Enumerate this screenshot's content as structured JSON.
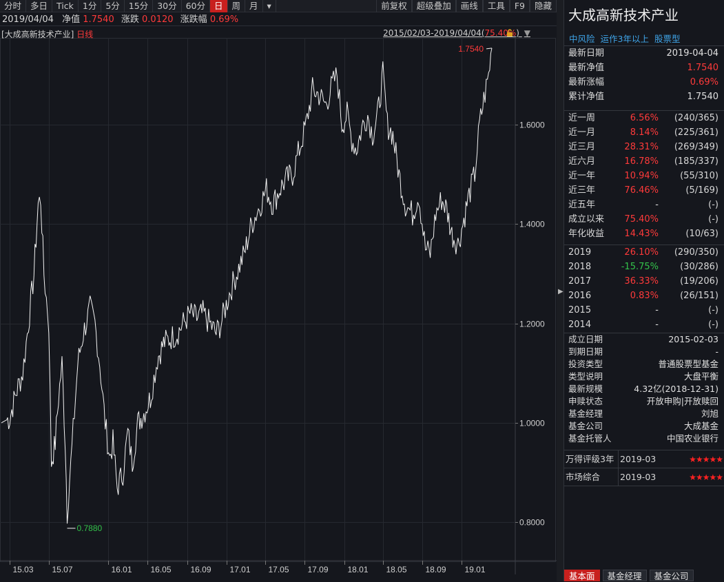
{
  "toolbar": {
    "items": [
      "分时",
      "多日",
      "Tick",
      "1分",
      "5分",
      "15分",
      "30分",
      "60分",
      "日",
      "周",
      "月",
      "▾"
    ],
    "active": "日",
    "right_items": [
      "前复权",
      "超级叠加",
      "画线",
      "工具",
      "F9",
      "隐藏"
    ]
  },
  "info_bar": {
    "date": "2019/04/04",
    "nav_label": "净值",
    "nav_value": "1.7540",
    "change_label": "涨跌",
    "change_value": "0.0120",
    "pct_label": "涨跌幅",
    "pct_value": "0.69%"
  },
  "chart": {
    "title": "[大成高新技术产业]",
    "period": "日线",
    "range": "2015/02/03-2019/04/04(",
    "range_pct": "75.40%",
    "range_close": ")",
    "max_label": "1.7540",
    "min_label": "0.7880"
  },
  "chart_data": {
    "type": "line",
    "title": "[大成高新技术产业] 日线",
    "xlabel": "",
    "ylabel": "",
    "x_ticks": [
      "15.03",
      "15.07",
      "16.01",
      "16.05",
      "16.09",
      "17.01",
      "17.05",
      "17.09",
      "18.01",
      "18.05",
      "18.09",
      "19.01"
    ],
    "y_ticks": [
      "0.8000",
      "1.0000",
      "1.2000",
      "1.4000",
      "1.6000"
    ],
    "ylim": [
      0.7,
      1.78
    ],
    "grid": true,
    "series": [
      {
        "name": "",
        "x": [
          "2015-02-03",
          "2015-03-01",
          "2015-03-20",
          "2015-04-10",
          "2015-04-28",
          "2015-05-15",
          "2015-05-28",
          "2015-06-05",
          "2015-06-15",
          "2015-06-30",
          "2015-07-08",
          "2015-07-20",
          "2015-07-30",
          "2015-08-10",
          "2015-08-20",
          "2015-08-26",
          "2015-09-10",
          "2015-09-28",
          "2015-10-15",
          "2015-11-05",
          "2015-11-20",
          "2015-12-05",
          "2015-12-22",
          "2016-01-05",
          "2016-01-15",
          "2016-01-28",
          "2016-02-15",
          "2016-03-01",
          "2016-03-15",
          "2016-04-01",
          "2016-04-20",
          "2016-05-10",
          "2016-06-01",
          "2016-06-20",
          "2016-07-10",
          "2016-08-01",
          "2016-08-20",
          "2016-09-10",
          "2016-10-01",
          "2016-10-20",
          "2016-11-10",
          "2016-11-30",
          "2016-12-15",
          "2017-01-10",
          "2017-02-01",
          "2017-02-25",
          "2017-03-20",
          "2017-04-10",
          "2017-05-05",
          "2017-05-25",
          "2017-06-15",
          "2017-07-05",
          "2017-07-25",
          "2017-08-15",
          "2017-09-05",
          "2017-09-25",
          "2017-10-15",
          "2017-11-05",
          "2017-11-25",
          "2017-12-10",
          "2017-12-25",
          "2018-01-10",
          "2018-01-25",
          "2018-02-08",
          "2018-02-28",
          "2018-03-15",
          "2018-03-30",
          "2018-04-15",
          "2018-05-01",
          "2018-05-15",
          "2018-06-01",
          "2018-06-20",
          "2018-07-10",
          "2018-08-01",
          "2018-08-20",
          "2018-09-10",
          "2018-09-25",
          "2018-10-12",
          "2018-10-30",
          "2018-11-15",
          "2018-12-01",
          "2018-12-20",
          "2019-01-04",
          "2019-01-20",
          "2019-02-10",
          "2019-02-25",
          "2019-03-10",
          "2019-03-25",
          "2019-04-04"
        ],
        "values": [
          1.0,
          1.01,
          1.06,
          1.1,
          1.2,
          1.3,
          1.44,
          1.45,
          1.3,
          1.2,
          0.92,
          0.96,
          1.05,
          1.12,
          0.96,
          0.82,
          0.95,
          1.12,
          1.18,
          1.23,
          1.2,
          1.12,
          1.0,
          0.93,
          0.96,
          0.87,
          0.9,
          0.98,
          0.92,
          1.0,
          1.02,
          1.05,
          1.13,
          1.16,
          1.17,
          1.18,
          1.2,
          1.22,
          1.21,
          1.22,
          1.2,
          1.18,
          1.2,
          1.26,
          1.3,
          1.34,
          1.4,
          1.43,
          1.47,
          1.44,
          1.47,
          1.49,
          1.5,
          1.55,
          1.6,
          1.67,
          1.66,
          1.64,
          1.68,
          1.7,
          1.6,
          1.62,
          1.57,
          1.55,
          1.6,
          1.62,
          1.58,
          1.62,
          1.7,
          1.6,
          1.58,
          1.5,
          1.44,
          1.42,
          1.46,
          1.35,
          1.34,
          1.42,
          1.45,
          1.43,
          1.38,
          1.36,
          1.4,
          1.45,
          1.5,
          1.6,
          1.65,
          1.7,
          1.754
        ]
      }
    ]
  },
  "panel": {
    "fund_name": "大成高新技术产业",
    "tags": [
      "中风险",
      "运作3年以上",
      "股票型"
    ],
    "summary": [
      {
        "k": "最新日期",
        "v": "2019-04-04",
        "c": "w"
      },
      {
        "k": "最新净值",
        "v": "1.7540",
        "c": "r"
      },
      {
        "k": "最新涨幅",
        "v": "0.69%",
        "c": "r"
      },
      {
        "k": "累计净值",
        "v": "1.7540",
        "c": "w"
      }
    ],
    "periods": [
      {
        "k": "近一周",
        "v": "6.56%",
        "rank": "(240/365)",
        "c": "r"
      },
      {
        "k": "近一月",
        "v": "8.14%",
        "rank": "(225/361)",
        "c": "r"
      },
      {
        "k": "近三月",
        "v": "28.31%",
        "rank": "(269/349)",
        "c": "r"
      },
      {
        "k": "近六月",
        "v": "16.78%",
        "rank": "(185/337)",
        "c": "r"
      },
      {
        "k": "近一年",
        "v": "10.94%",
        "rank": "(55/310)",
        "c": "r"
      },
      {
        "k": "近三年",
        "v": "76.46%",
        "rank": "(5/169)",
        "c": "r"
      },
      {
        "k": "近五年",
        "v": "-",
        "rank": "(-)",
        "c": "w"
      },
      {
        "k": "成立以来",
        "v": "75.40%",
        "rank": "(-)",
        "c": "r"
      },
      {
        "k": "年化收益",
        "v": "14.43%",
        "rank": "(10/63)",
        "c": "r"
      }
    ],
    "years": [
      {
        "k": "2019",
        "v": "26.10%",
        "rank": "(290/350)",
        "c": "r"
      },
      {
        "k": "2018",
        "v": "-15.75%",
        "rank": "(30/286)",
        "c": "g"
      },
      {
        "k": "2017",
        "v": "36.33%",
        "rank": "(19/206)",
        "c": "r"
      },
      {
        "k": "2016",
        "v": "0.83%",
        "rank": "(26/151)",
        "c": "r"
      },
      {
        "k": "2015",
        "v": "-",
        "rank": "(-)",
        "c": "w"
      },
      {
        "k": "2014",
        "v": "-",
        "rank": "(-)",
        "c": "w"
      }
    ],
    "info": [
      {
        "k": "成立日期",
        "v": "2015-02-03"
      },
      {
        "k": "到期日期",
        "v": "-"
      },
      {
        "k": "投资类型",
        "v": "普通股票型基金"
      },
      {
        "k": "类型说明",
        "v": "大盘平衡"
      },
      {
        "k": "最新规模",
        "v": "4.32亿(2018-12-31)"
      },
      {
        "k": "申赎状态",
        "v": "开放申购|开放赎回"
      },
      {
        "k": "基金经理",
        "v": "刘旭"
      },
      {
        "k": "基金公司",
        "v": "大成基金"
      },
      {
        "k": "基金托管人",
        "v": "中国农业银行"
      }
    ],
    "ratings": [
      {
        "k": "万得评级3年",
        "d": "2019-03",
        "stars": "★★★★★"
      },
      {
        "k": "市场综合",
        "d": "2019-03",
        "stars": "★★★★★"
      }
    ],
    "tabs": [
      "基本面",
      "基金经理",
      "基金公司"
    ]
  },
  "colors": {
    "up": "#ff3a3a",
    "down": "#33c24a",
    "accent": "#c8201e",
    "link": "#3fa4e8"
  }
}
